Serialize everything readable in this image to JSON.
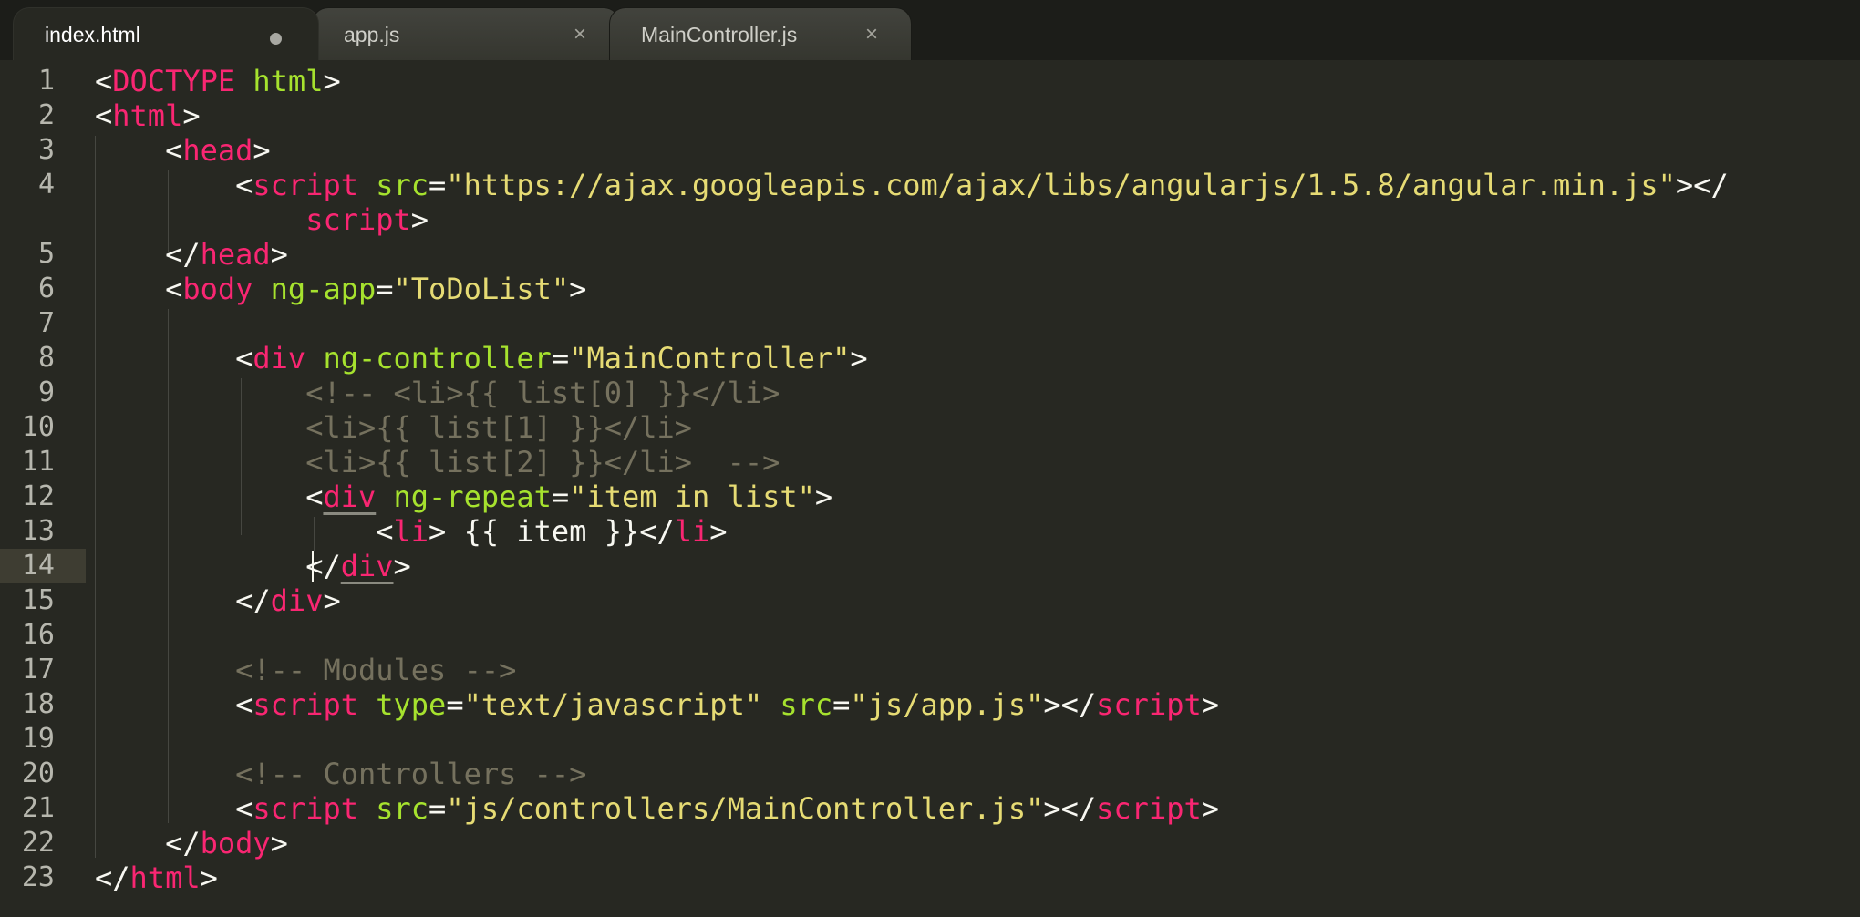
{
  "tabs": [
    {
      "label": "index.html",
      "active": true,
      "modified": true
    },
    {
      "label": "app.js",
      "active": false,
      "close_icon": "×"
    },
    {
      "label": "MainController.js",
      "active": false,
      "close_icon": "×"
    }
  ],
  "active_line": "14",
  "colors": {
    "background": "#272822",
    "tag": "#f92672",
    "attribute": "#a6e22e",
    "string": "#e6db74",
    "comment": "#75715e",
    "text": "#f8f8f2"
  },
  "lines": [
    {
      "n": "1",
      "tokens": [
        [
          "w",
          "<"
        ],
        [
          "t",
          "DOCTYPE"
        ],
        [
          "w",
          " "
        ],
        [
          "a",
          "html"
        ],
        [
          "w",
          ">"
        ]
      ]
    },
    {
      "n": "2",
      "tokens": [
        [
          "w",
          "<"
        ],
        [
          "t",
          "html"
        ],
        [
          "w",
          ">"
        ]
      ]
    },
    {
      "n": "3",
      "tokens": [
        [
          "w",
          "    <"
        ],
        [
          "t",
          "head"
        ],
        [
          "w",
          ">"
        ]
      ]
    },
    {
      "n": "4",
      "tokens": [
        [
          "w",
          "        <"
        ],
        [
          "t",
          "script"
        ],
        [
          "w",
          " "
        ],
        [
          "a",
          "src"
        ],
        [
          "w",
          "="
        ],
        [
          "s",
          "\"https://ajax.googleapis.com/ajax/libs/angularjs/1.5.8/angular.min.js\""
        ],
        [
          "w",
          "></"
        ]
      ]
    },
    {
      "n": "",
      "tokens": [
        [
          "w",
          "            "
        ],
        [
          "t",
          "script"
        ],
        [
          "w",
          ">"
        ]
      ]
    },
    {
      "n": "5",
      "tokens": [
        [
          "w",
          "    </"
        ],
        [
          "t",
          "head"
        ],
        [
          "w",
          ">"
        ]
      ]
    },
    {
      "n": "6",
      "tokens": [
        [
          "w",
          "    <"
        ],
        [
          "t",
          "body"
        ],
        [
          "w",
          " "
        ],
        [
          "a",
          "ng-app"
        ],
        [
          "w",
          "="
        ],
        [
          "s",
          "\"ToDoList\""
        ],
        [
          "w",
          ">"
        ]
      ]
    },
    {
      "n": "7",
      "tokens": []
    },
    {
      "n": "8",
      "tokens": [
        [
          "w",
          "        <"
        ],
        [
          "t",
          "div"
        ],
        [
          "w",
          " "
        ],
        [
          "a",
          "ng-controller"
        ],
        [
          "w",
          "="
        ],
        [
          "s",
          "\"MainController\""
        ],
        [
          "w",
          ">"
        ]
      ]
    },
    {
      "n": "9",
      "tokens": [
        [
          "w",
          "            "
        ],
        [
          "c",
          "<!-- <li>{{ list[0] }}</li>"
        ]
      ]
    },
    {
      "n": "10",
      "tokens": [
        [
          "w",
          "            "
        ],
        [
          "c",
          "<li>{{ list[1] }}</li>"
        ]
      ]
    },
    {
      "n": "11",
      "tokens": [
        [
          "w",
          "            "
        ],
        [
          "c",
          "<li>{{ list[2] }}</li>  -->"
        ]
      ]
    },
    {
      "n": "12",
      "tokens": [
        [
          "w",
          "            <"
        ],
        [
          "tu",
          "div"
        ],
        [
          "w",
          " "
        ],
        [
          "a",
          "ng-repeat"
        ],
        [
          "w",
          "="
        ],
        [
          "s",
          "\"item in list\""
        ],
        [
          "w",
          ">"
        ]
      ]
    },
    {
      "n": "13",
      "tokens": [
        [
          "w",
          "                <"
        ],
        [
          "t",
          "li"
        ],
        [
          "w",
          "> {{ item }}</"
        ],
        [
          "t",
          "li"
        ],
        [
          "w",
          ">"
        ]
      ]
    },
    {
      "n": "14",
      "tokens": [
        [
          "w",
          "            </"
        ],
        [
          "tu",
          "div"
        ],
        [
          "w",
          ">"
        ]
      ]
    },
    {
      "n": "15",
      "tokens": [
        [
          "w",
          "        </"
        ],
        [
          "t",
          "div"
        ],
        [
          "w",
          ">"
        ]
      ]
    },
    {
      "n": "16",
      "tokens": []
    },
    {
      "n": "17",
      "tokens": [
        [
          "w",
          "        "
        ],
        [
          "c",
          "<!-- Modules -->"
        ]
      ]
    },
    {
      "n": "18",
      "tokens": [
        [
          "w",
          "        <"
        ],
        [
          "t",
          "script"
        ],
        [
          "w",
          " "
        ],
        [
          "a",
          "type"
        ],
        [
          "w",
          "="
        ],
        [
          "s",
          "\"text/javascript\""
        ],
        [
          "w",
          " "
        ],
        [
          "a",
          "src"
        ],
        [
          "w",
          "="
        ],
        [
          "s",
          "\"js/app.js\""
        ],
        [
          "w",
          "></"
        ],
        [
          "t",
          "script"
        ],
        [
          "w",
          ">"
        ]
      ]
    },
    {
      "n": "19",
      "tokens": []
    },
    {
      "n": "20",
      "tokens": [
        [
          "w",
          "        "
        ],
        [
          "c",
          "<!-- Controllers -->"
        ]
      ]
    },
    {
      "n": "21",
      "tokens": [
        [
          "w",
          "        <"
        ],
        [
          "t",
          "script"
        ],
        [
          "w",
          " "
        ],
        [
          "a",
          "src"
        ],
        [
          "w",
          "="
        ],
        [
          "s",
          "\"js/controllers/MainController.js\""
        ],
        [
          "w",
          "></"
        ],
        [
          "t",
          "script"
        ],
        [
          "w",
          ">"
        ]
      ]
    },
    {
      "n": "22",
      "tokens": [
        [
          "w",
          "    </"
        ],
        [
          "t",
          "body"
        ],
        [
          "w",
          ">"
        ]
      ]
    },
    {
      "n": "23",
      "tokens": [
        [
          "w",
          "</"
        ],
        [
          "t",
          "html"
        ],
        [
          "w",
          ">"
        ]
      ]
    }
  ]
}
